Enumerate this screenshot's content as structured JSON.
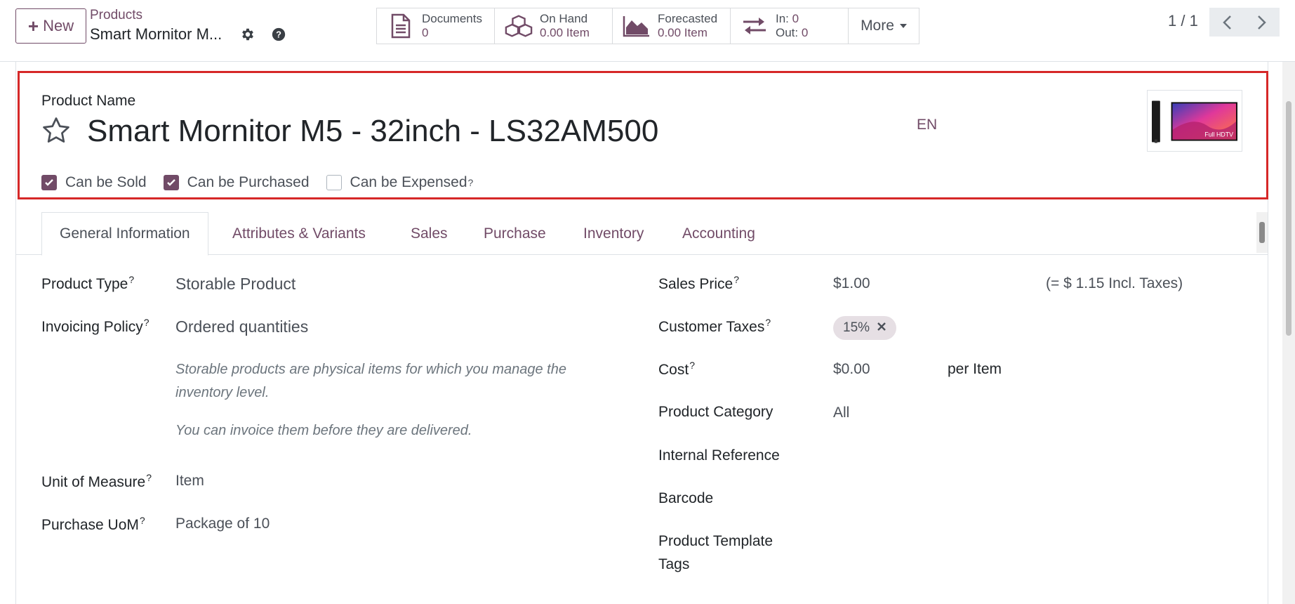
{
  "control_panel": {
    "new_button": "New",
    "breadcrumb_parent": "Products",
    "breadcrumb_current": "Smart Mornitor M...",
    "stats": [
      {
        "label": "Documents",
        "value": "0",
        "icon": "document-icon"
      },
      {
        "label": "On Hand",
        "value": "0.00 Item",
        "icon": "cubes-icon"
      },
      {
        "label": "Forecasted",
        "value": "0.00 Item",
        "icon": "area-chart-icon"
      }
    ],
    "moves": {
      "in_label": "In:",
      "in_value": "0",
      "out_label": "Out:",
      "out_value": "0",
      "icon": "exchange-arrows-icon"
    },
    "more_label": "More",
    "pager": "1 / 1"
  },
  "product": {
    "name_label": "Product Name",
    "name": "Smart Mornitor M5 - 32inch - LS32AM500",
    "lang": "EN",
    "image_caption": "Full HDTV",
    "checkboxes": [
      {
        "label": "Can be Sold",
        "checked": true,
        "help": ""
      },
      {
        "label": "Can be Purchased",
        "checked": true,
        "help": ""
      },
      {
        "label": "Can be Expensed",
        "checked": false,
        "help": "?"
      }
    ]
  },
  "tabs": [
    "General Information",
    "Attributes & Variants",
    "Sales",
    "Purchase",
    "Inventory",
    "Accounting"
  ],
  "left_fields": {
    "product_type_label": "Product Type",
    "product_type": "Storable Product",
    "invoicing_policy_label": "Invoicing Policy",
    "invoicing_policy": "Ordered quantities",
    "help_line1": "Storable products are physical items for which you manage the inventory level.",
    "help_line2": "You can invoice them before they are delivered.",
    "uom_label": "Unit of Measure",
    "uom": "Item",
    "purchase_uom_label": "Purchase UoM",
    "purchase_uom": "Package of 10",
    "help_mark": "?"
  },
  "right_fields": {
    "sales_price_label": "Sales Price",
    "sales_price": "$1.00",
    "sales_price_incl": "(= $ 1.15 Incl. Taxes)",
    "customer_taxes_label": "Customer Taxes",
    "tax_tag": "15%",
    "cost_label": "Cost",
    "cost": "$0.00",
    "cost_unit": "per Item",
    "category_label": "Product Category",
    "category": "All",
    "internal_ref_label": "Internal Reference",
    "barcode_label": "Barcode",
    "template_tags_label_1": "Product Template",
    "template_tags_label_2": "Tags"
  },
  "colors": {
    "brand": "#714b67",
    "highlight": "#d62828"
  }
}
